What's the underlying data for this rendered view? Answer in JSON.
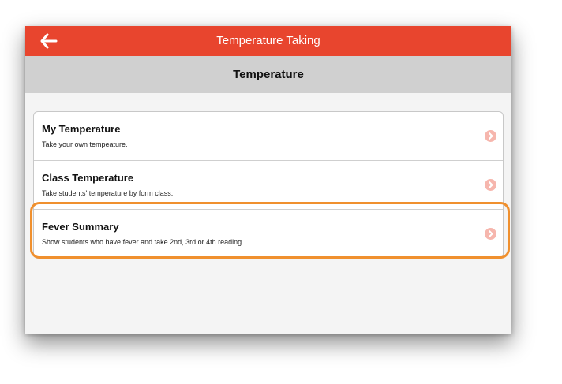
{
  "header": {
    "title": "Temperature Taking",
    "back_icon": "arrow-left-icon",
    "color": "#e8452e"
  },
  "subheader": {
    "title": "Temperature"
  },
  "menu": {
    "items": [
      {
        "label": "My Temperature",
        "description": "Take your own tempeature.",
        "icon": "chevron-right-circle-icon"
      },
      {
        "label": "Class Temperature",
        "description": "Take students' temperature by form class.",
        "icon": "chevron-right-circle-icon"
      },
      {
        "label": "Fever Summary",
        "description": "Show students who have fever and take 2nd, 3rd or 4th reading.",
        "icon": "chevron-right-circle-icon",
        "highlighted": true
      }
    ]
  },
  "highlight_color": "#f0902e"
}
